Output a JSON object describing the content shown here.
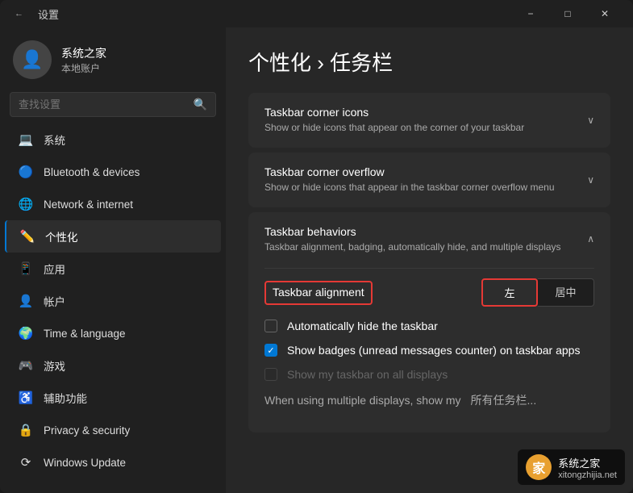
{
  "window": {
    "title": "设置",
    "back_icon": "←",
    "min_label": "−",
    "max_label": "□",
    "close_label": "✕"
  },
  "sidebar": {
    "user": {
      "name": "系统之家",
      "sub": "本地账户",
      "avatar_icon": "👤"
    },
    "search_placeholder": "查找设置",
    "search_icon": "🔍",
    "items": [
      {
        "id": "system",
        "label": "系统",
        "icon": "💻"
      },
      {
        "id": "bluetooth",
        "label": "Bluetooth & devices",
        "icon": "🔵"
      },
      {
        "id": "network",
        "label": "Network & internet",
        "icon": "🌐"
      },
      {
        "id": "personalization",
        "label": "个性化",
        "icon": "✏️",
        "active": true
      },
      {
        "id": "apps",
        "label": "应用",
        "icon": "📱"
      },
      {
        "id": "accounts",
        "label": "帐户",
        "icon": "👤"
      },
      {
        "id": "time",
        "label": "Time & language",
        "icon": "🌍"
      },
      {
        "id": "gaming",
        "label": "游戏",
        "icon": "🎮"
      },
      {
        "id": "accessibility",
        "label": "辅助功能",
        "icon": "♿"
      },
      {
        "id": "privacy",
        "label": "Privacy & security",
        "icon": "🔒"
      },
      {
        "id": "update",
        "label": "Windows Update",
        "icon": "⟳"
      }
    ]
  },
  "content": {
    "breadcrumb": "个性化 › 任务栏",
    "cards": [
      {
        "id": "corner-icons",
        "title": "Taskbar corner icons",
        "subtitle": "Show or hide icons that appear on the corner of your taskbar",
        "expanded": false
      },
      {
        "id": "corner-overflow",
        "title": "Taskbar corner overflow",
        "subtitle": "Show or hide icons that appear in the taskbar corner overflow menu",
        "expanded": false
      },
      {
        "id": "behaviors",
        "title": "Taskbar behaviors",
        "subtitle": "Taskbar alignment, badging, automatically hide, and multiple displays",
        "expanded": true,
        "alignment_label": "Taskbar alignment",
        "alignment_options": [
          {
            "label": "左",
            "selected": true
          },
          {
            "label": "居中",
            "selected": false
          }
        ],
        "checkboxes": [
          {
            "id": "auto-hide",
            "label": "Automatically hide the taskbar",
            "checked": false,
            "disabled": false
          },
          {
            "id": "show-badges",
            "label": "Show badges (unread messages counter) on taskbar apps",
            "checked": true,
            "disabled": false
          },
          {
            "id": "show-all-displays",
            "label": "Show my taskbar on all displays",
            "checked": false,
            "disabled": true
          }
        ],
        "partial_row": {
          "label": "When using multiple displays, show my",
          "value": "所有任务栏..."
        }
      }
    ]
  },
  "watermark": {
    "logo_text": "家",
    "text": "系统之家",
    "sub": "xitongzhijia.net"
  }
}
